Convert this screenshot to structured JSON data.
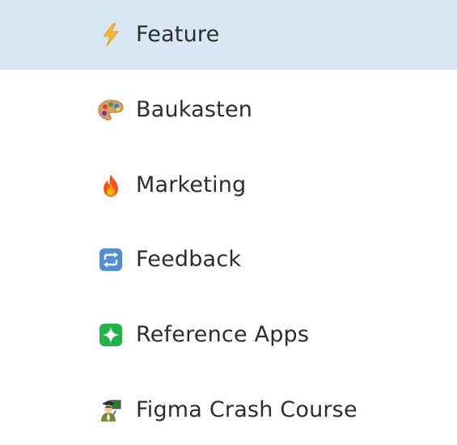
{
  "sidebar": {
    "selected_index": 0,
    "items": [
      {
        "label": "Feature",
        "icon": "lightning-icon"
      },
      {
        "label": "Baukasten",
        "icon": "palette-icon"
      },
      {
        "label": "Marketing",
        "icon": "fire-icon"
      },
      {
        "label": "Feedback",
        "icon": "repeat-arrows-icon"
      },
      {
        "label": "Reference Apps",
        "icon": "sparkle-icon"
      },
      {
        "label": "Figma Crash Course",
        "icon": "teacher-icon"
      }
    ]
  },
  "colors": {
    "selected_background": "#d9e7f5",
    "text": "#2d2d2d"
  }
}
